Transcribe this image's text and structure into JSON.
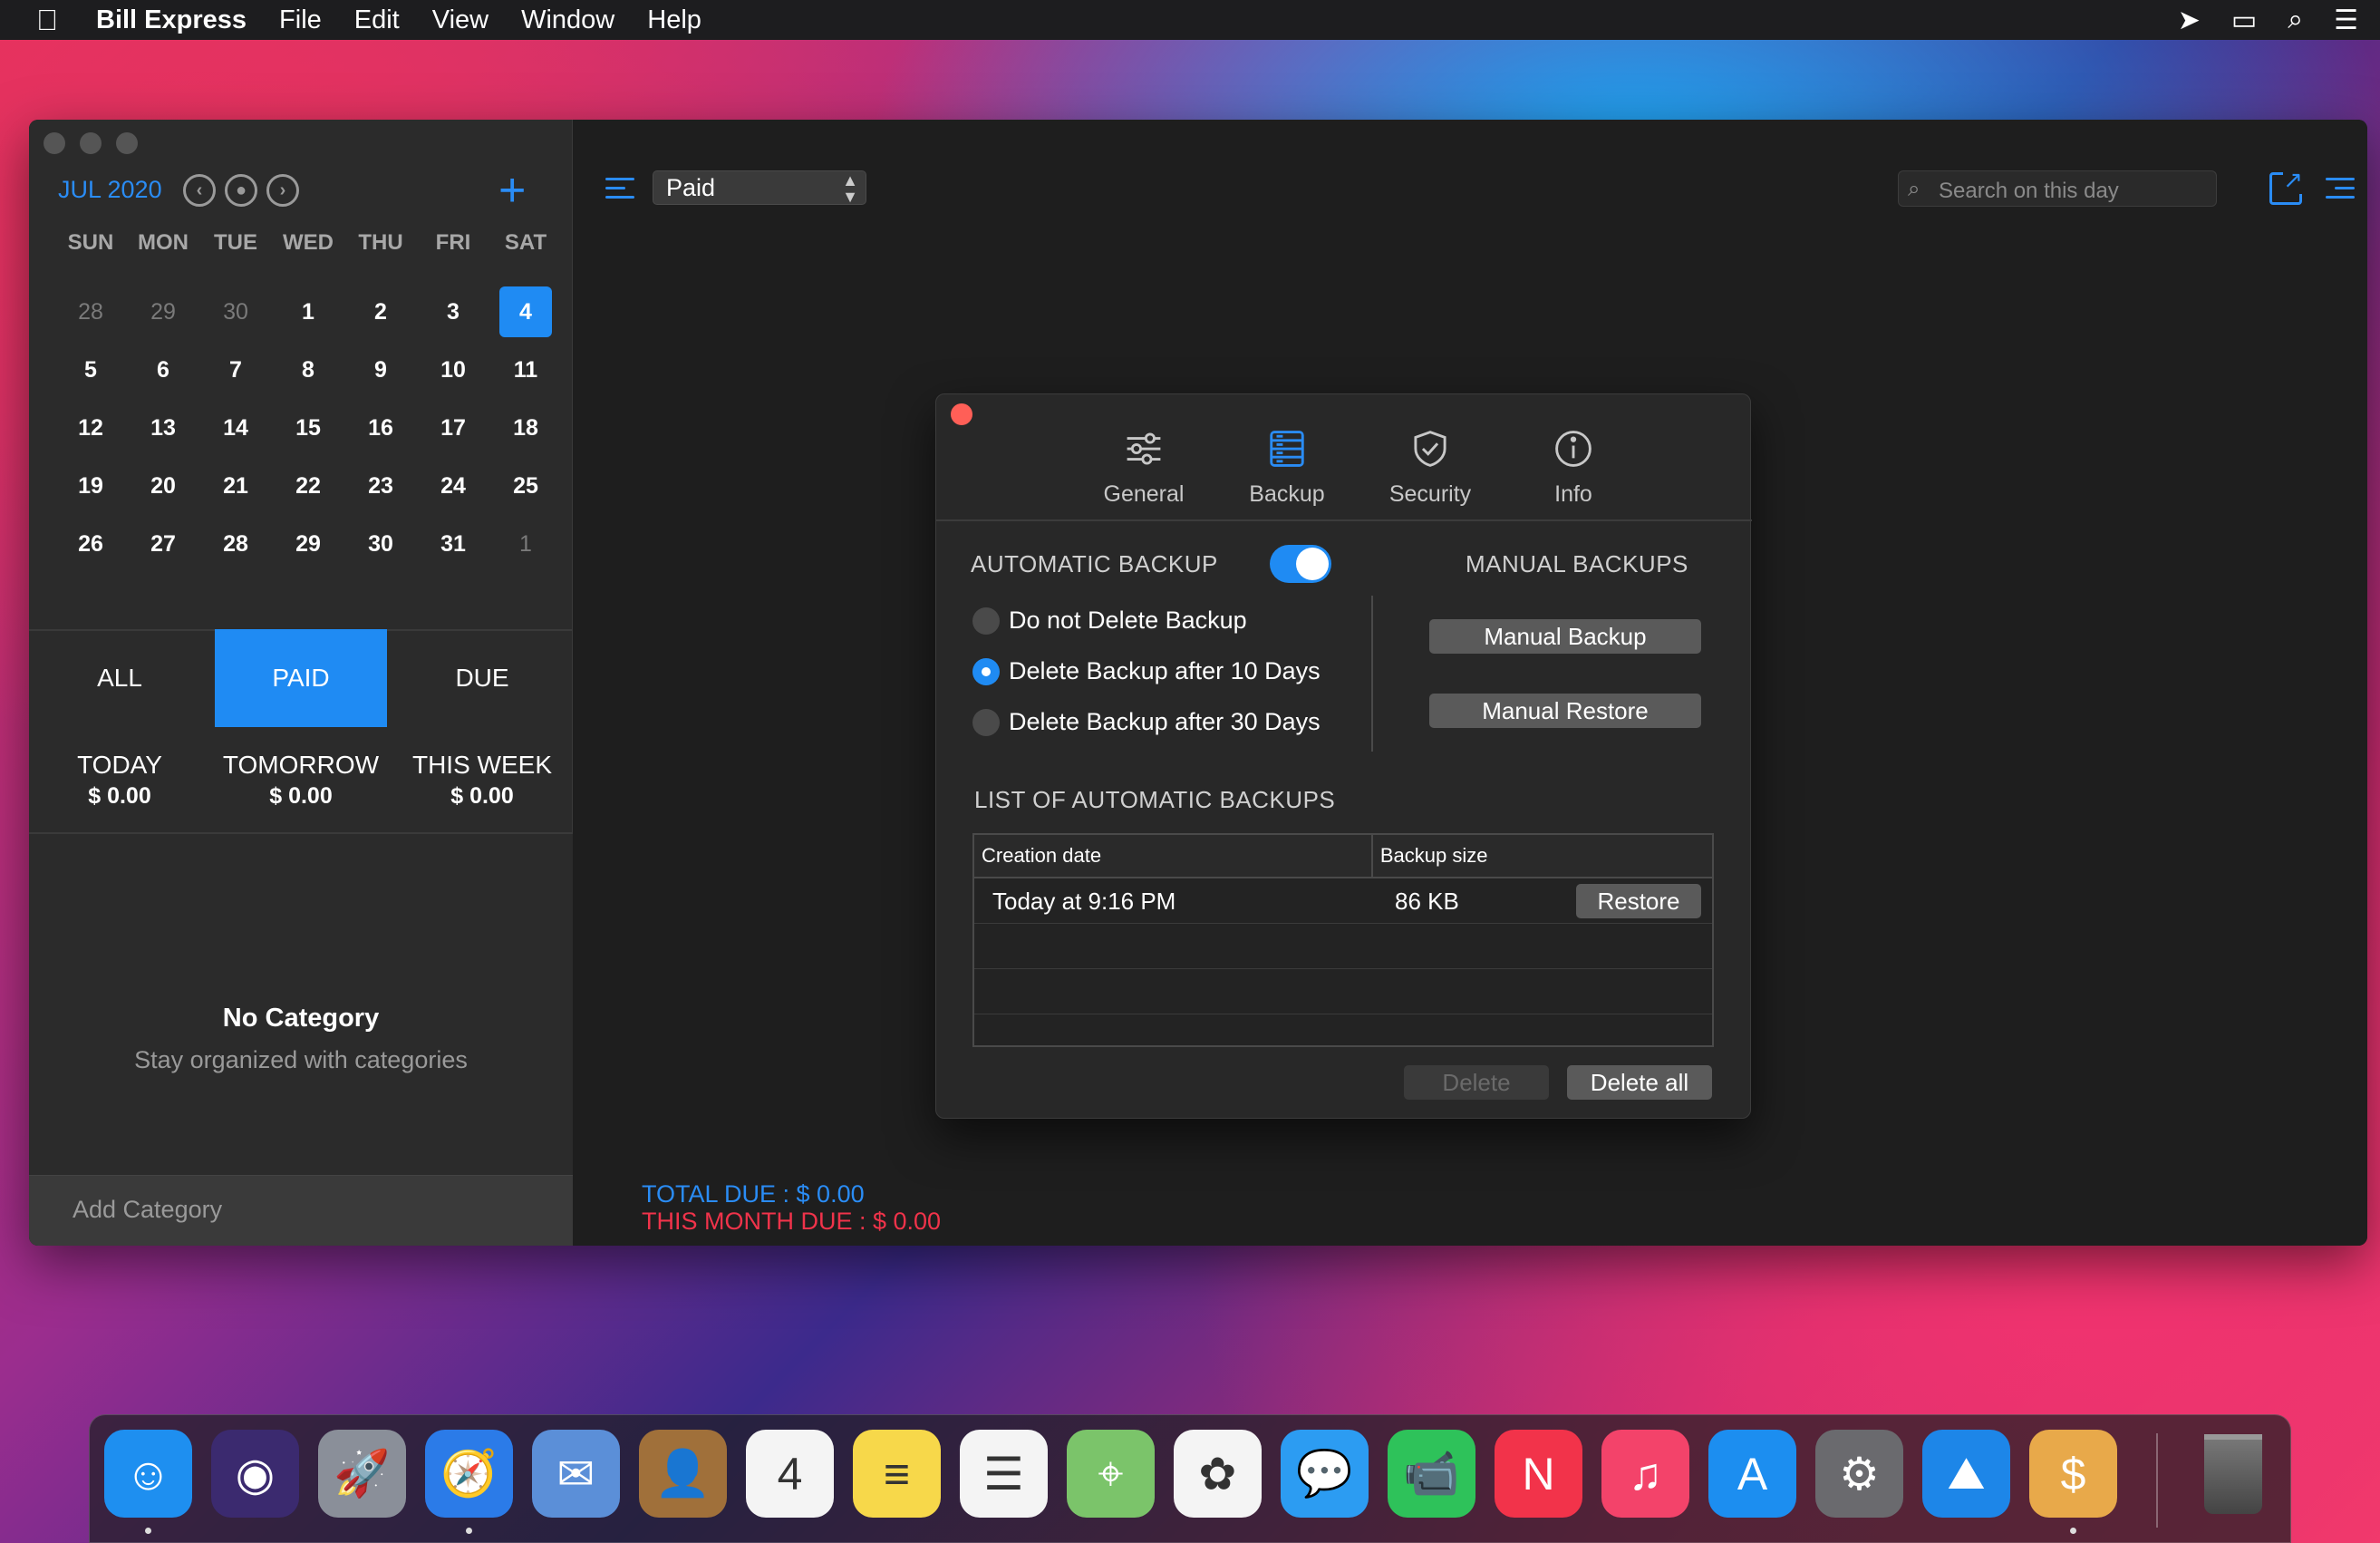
{
  "menubar": {
    "app": "Bill Express",
    "items": [
      "File",
      "Edit",
      "View",
      "Window",
      "Help"
    ],
    "status_icons": [
      "location-icon",
      "display-icon",
      "search-icon",
      "control-center-icon"
    ]
  },
  "calendar": {
    "month": "JUL 2020",
    "weekdays": [
      "SUN",
      "MON",
      "TUE",
      "WED",
      "THU",
      "FRI",
      "SAT"
    ],
    "days": [
      {
        "d": "28",
        "muted": true
      },
      {
        "d": "29",
        "muted": true
      },
      {
        "d": "30",
        "muted": true
      },
      {
        "d": "1"
      },
      {
        "d": "2"
      },
      {
        "d": "3"
      },
      {
        "d": "4",
        "selected": true
      },
      {
        "d": "5"
      },
      {
        "d": "6"
      },
      {
        "d": "7"
      },
      {
        "d": "8"
      },
      {
        "d": "9"
      },
      {
        "d": "10"
      },
      {
        "d": "11"
      },
      {
        "d": "12"
      },
      {
        "d": "13"
      },
      {
        "d": "14"
      },
      {
        "d": "15"
      },
      {
        "d": "16"
      },
      {
        "d": "17"
      },
      {
        "d": "18"
      },
      {
        "d": "19"
      },
      {
        "d": "20"
      },
      {
        "d": "21"
      },
      {
        "d": "22"
      },
      {
        "d": "23"
      },
      {
        "d": "24"
      },
      {
        "d": "25"
      },
      {
        "d": "26"
      },
      {
        "d": "27"
      },
      {
        "d": "28"
      },
      {
        "d": "29"
      },
      {
        "d": "30"
      },
      {
        "d": "31"
      },
      {
        "d": "1",
        "muted": true
      }
    ]
  },
  "filters": {
    "all": "ALL",
    "paid": "PAID",
    "due": "DUE",
    "active": "paid"
  },
  "summary": {
    "today_label": "TODAY",
    "today_amount": "$ 0.00",
    "tomorrow_label": "TOMORROW",
    "tomorrow_amount": "$ 0.00",
    "week_label": "THIS WEEK",
    "week_amount": "$ 0.00"
  },
  "categories": {
    "empty_title": "No Category",
    "empty_subtitle": "Stay organized with categories",
    "add_label": "Add Category"
  },
  "toolbar": {
    "filter_value": "Paid",
    "search_placeholder": "Search on this day"
  },
  "totals": {
    "total_due": "TOTAL DUE : $ 0.00",
    "month_due": "THIS MONTH DUE : $ 0.00"
  },
  "prefs": {
    "tabs": [
      {
        "label": "General",
        "icon": "sliders-icon"
      },
      {
        "label": "Backup",
        "icon": "backup-icon",
        "active": true
      },
      {
        "label": "Security",
        "icon": "shield-icon"
      },
      {
        "label": "Info",
        "icon": "info-icon"
      }
    ],
    "auto_backup_title": "AUTOMATIC BACKUP",
    "auto_backup_enabled": true,
    "options": [
      {
        "label": "Do not Delete Backup",
        "selected": false
      },
      {
        "label": "Delete Backup after 10 Days",
        "selected": true
      },
      {
        "label": "Delete Backup after 30 Days",
        "selected": false
      }
    ],
    "manual_title": "MANUAL BACKUPS",
    "manual_backup": "Manual Backup",
    "manual_restore": "Manual Restore",
    "list_title": "LIST OF AUTOMATIC BACKUPS",
    "columns": [
      "Creation date",
      "Backup size"
    ],
    "rows": [
      {
        "date": "Today at 9:16 PM",
        "size": "86 KB",
        "action": "Restore"
      }
    ],
    "delete": "Delete",
    "delete_all": "Delete all"
  },
  "dock": {
    "apps": [
      {
        "name": "finder-icon",
        "glyph": "☺",
        "bg": "#1e8ff0",
        "running": true
      },
      {
        "name": "siri-icon",
        "glyph": "◉",
        "bg": "#3b2a6f"
      },
      {
        "name": "launchpad-icon",
        "glyph": "🚀",
        "bg": "#8a8f99"
      },
      {
        "name": "safari-icon",
        "glyph": "🧭",
        "bg": "#2b7be8",
        "running": true
      },
      {
        "name": "mail-icon",
        "glyph": "✉",
        "bg": "#5b8fd8"
      },
      {
        "name": "contacts-icon",
        "glyph": "👤",
        "bg": "#a0703a"
      },
      {
        "name": "calendar-icon",
        "glyph": "4",
        "bg": "#f4f4f4"
      },
      {
        "name": "notes-icon",
        "glyph": "≡",
        "bg": "#f7d84a"
      },
      {
        "name": "reminders-icon",
        "glyph": "☰",
        "bg": "#f4f4f4"
      },
      {
        "name": "maps-icon",
        "glyph": "⌖",
        "bg": "#7bc46a"
      },
      {
        "name": "photos-icon",
        "glyph": "✿",
        "bg": "#f4f4f4"
      },
      {
        "name": "messages-icon",
        "glyph": "💬",
        "bg": "#2c9cf2"
      },
      {
        "name": "facetime-icon",
        "glyph": "📹",
        "bg": "#2ec25a"
      },
      {
        "name": "news-icon",
        "glyph": "N",
        "bg": "#f2334a"
      },
      {
        "name": "music-icon",
        "glyph": "♫",
        "bg": "#f3436a"
      },
      {
        "name": "app-store-icon",
        "glyph": "A",
        "bg": "#1c8ef0"
      },
      {
        "name": "system-preferences-icon",
        "glyph": "⚙",
        "bg": "#6a6a6e"
      },
      {
        "name": "app-icon-mountain",
        "glyph": "⛰",
        "bg": "#1d86e8"
      },
      {
        "name": "bill-express-icon",
        "glyph": "$",
        "bg": "#e8a94a",
        "running": true
      }
    ]
  }
}
